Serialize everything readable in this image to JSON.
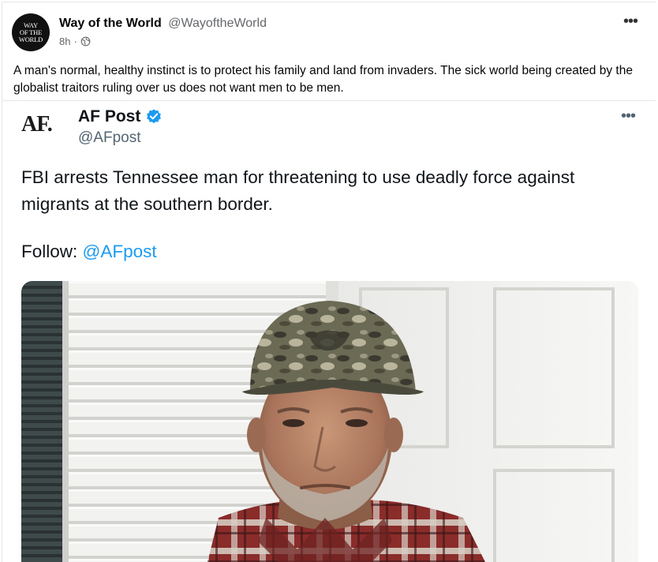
{
  "post": {
    "author_name": "Way of the World",
    "author_handle": "@WayoftheWorld",
    "avatar_text": [
      "WAY",
      "OF THE",
      "WORLD"
    ],
    "time": "8h",
    "dot": "·",
    "visibility_icon": "globe-icon",
    "more_label": "•••",
    "text": "A man's normal, healthy instinct is to protect his family and land from invaders. The sick world being created by the globalist traitors ruling over us does not want men to be men."
  },
  "embed": {
    "logo_text": "AF.",
    "name": "AF Post",
    "handle": "@AFpost",
    "verified_icon": "verified-badge-icon",
    "more_label": "•••",
    "text": "FBI arrests Tennessee man for threatening to use deadly force against migrants at the southern border.",
    "follow_prefix": "Follow: ",
    "follow_link": "@AFpost",
    "photo_icon": "photo-of-man-in-camo-cap"
  },
  "colors": {
    "link": "#1d9bf0",
    "muted": "#65676b",
    "verified": "#1d9bf0"
  }
}
